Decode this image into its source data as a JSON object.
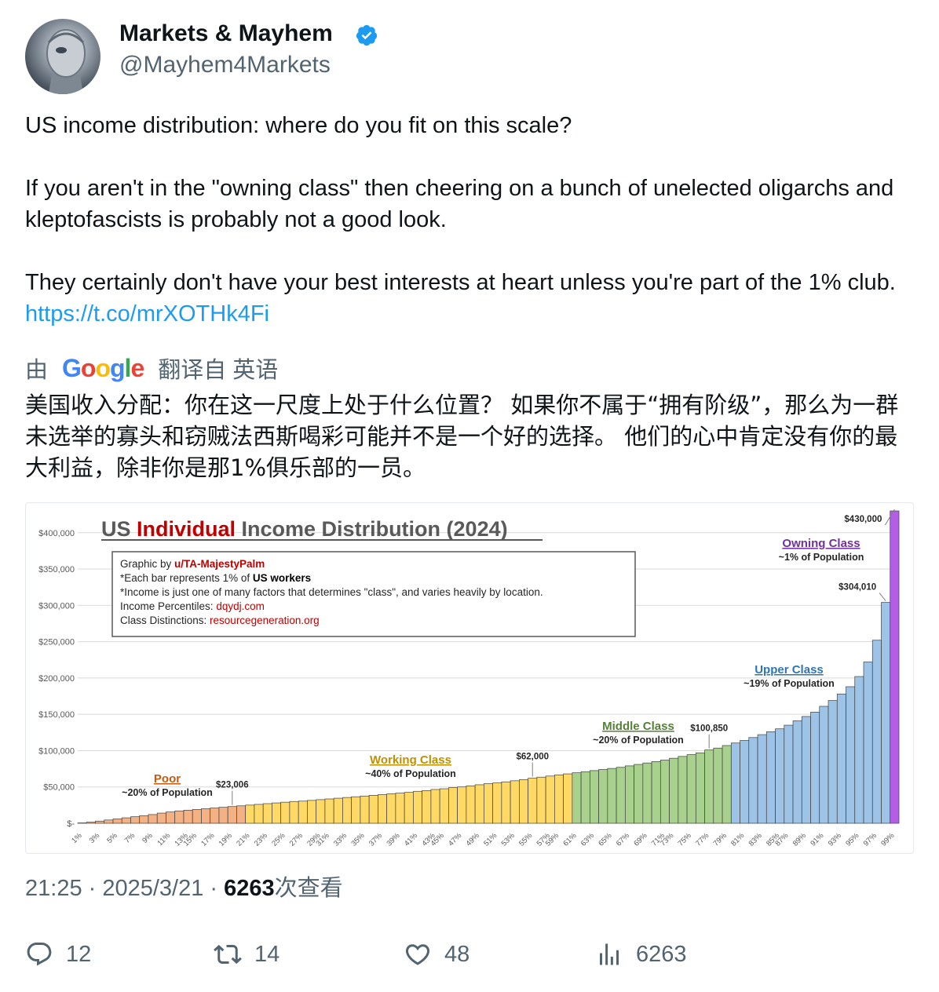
{
  "author": {
    "display_name": "Markets & Mayhem",
    "handle": "@Mayhem4Markets",
    "verified": true,
    "avatar_icon": "robot-avatar-icon"
  },
  "tweet": {
    "line1": "US income distribution: where do you fit on this scale?",
    "line2": "If you aren't in the \"owning class\" then cheering on a bunch of unelected oligarchs and kleptofascists is probably not a good look.",
    "line3": "They certainly don't have your best interests at heart unless you're part of the 1% club.",
    "link": "https://t.co/mrXOTHk4Fi"
  },
  "translation": {
    "prefix": "由",
    "provider": "Google",
    "suffix": "翻译自 英语",
    "text": "美国收入分配：你在这一尺度上处于什么位置？ 如果你不属于“拥有阶级”，那么为一群未选举的寡头和窃贼法西斯喝彩可能并不是一个好的选择。 他们的心中肯定没有你的最大利益，除非你是那1%俱乐部的一员。"
  },
  "chart_data": {
    "type": "bar",
    "title_parts": [
      "US ",
      "Individual",
      " Income Distribution (2024)"
    ],
    "info_lines": [
      {
        "a": "Graphic by ",
        "b": "u/TA-MajestyPalm",
        "c": ""
      },
      {
        "a": "*Each bar represents 1% of ",
        "b": "US workers",
        "c": ""
      },
      {
        "a": "*Income is just one of many factors that determines \"class\", and varies heavily by location.",
        "b": "",
        "c": ""
      },
      {
        "a": "Income Percentiles: ",
        "b": "dqydj.com",
        "c": ""
      },
      {
        "a": "Class Distinctions: ",
        "b": "resourcegeneration.org",
        "c": ""
      }
    ],
    "y_ticks": [
      {
        "v": 0,
        "label": "$-"
      },
      {
        "v": 50000,
        "label": "$50,000"
      },
      {
        "v": 100000,
        "label": "$100,000"
      },
      {
        "v": 150000,
        "label": "$150,000"
      },
      {
        "v": 200000,
        "label": "$200,000"
      },
      {
        "v": 250000,
        "label": "$250,000"
      },
      {
        "v": 300000,
        "label": "$300,000"
      },
      {
        "v": 350000,
        "label": "$350,000"
      },
      {
        "v": 400000,
        "label": "$400,000"
      }
    ],
    "ylim": [
      0,
      430000
    ],
    "x_tick_labels": [
      "1%",
      "3%",
      "5%",
      "7%",
      "9%",
      "11%",
      "13%",
      "15%",
      "17%",
      "19%",
      "21%",
      "23%",
      "25%",
      "27%",
      "29%",
      "31%",
      "33%",
      "35%",
      "37%",
      "39%",
      "41%",
      "43%",
      "45%",
      "47%",
      "49%",
      "51%",
      "53%",
      "55%",
      "57%",
      "59%",
      "61%",
      "63%",
      "65%",
      "67%",
      "69%",
      "71%",
      "73%",
      "75%",
      "77%",
      "79%",
      "81%",
      "83%",
      "85%",
      "87%",
      "89%",
      "91%",
      "93%",
      "95%",
      "97%",
      "99%"
    ],
    "values": [
      500,
      1500,
      3000,
      4500,
      6000,
      7500,
      9000,
      10500,
      12000,
      14000,
      15500,
      17000,
      18000,
      19000,
      20000,
      21000,
      22000,
      23006,
      24000,
      25000,
      26000,
      27000,
      28000,
      29000,
      30000,
      30500,
      31500,
      32500,
      33500,
      34500,
      35500,
      36500,
      37500,
      38500,
      39500,
      40500,
      41500,
      42500,
      44000,
      45000,
      46500,
      47500,
      49000,
      50000,
      51500,
      53000,
      54500,
      55500,
      57000,
      58500,
      60000,
      62000,
      63500,
      65000,
      66500,
      68000,
      69500,
      71000,
      72500,
      74000,
      75500,
      77000,
      79000,
      81000,
      83000,
      85000,
      87000,
      89500,
      92000,
      94500,
      97000,
      100850,
      103500,
      107000,
      110500,
      114000,
      118000,
      122000,
      126000,
      130000,
      135000,
      141000,
      147000,
      153000,
      161000,
      169000,
      178000,
      188000,
      202000,
      222000,
      252000,
      304010,
      430000
    ],
    "class_ranges": [
      {
        "name": "Poor",
        "sub": "~20% of Population",
        "start": 0,
        "end": 20,
        "color": "#f4b183",
        "label_color": "#c55a11"
      },
      {
        "name": "Working Class",
        "sub": "~40% of Population",
        "start": 20,
        "end": 60,
        "color": "#ffd966",
        "label_color": "#bf9000"
      },
      {
        "name": "Middle Class",
        "sub": "~20% of Population",
        "start": 60,
        "end": 80,
        "color": "#a9d18e",
        "label_color": "#548235"
      },
      {
        "name": "Upper Class",
        "sub": "~19% of Population",
        "start": 80,
        "end": 99,
        "color": "#9dc3e6",
        "label_color": "#2e75b6"
      },
      {
        "name": "Owning Class",
        "sub": "~1% of Population",
        "start": 99,
        "end": 100,
        "color": "#b45ee6",
        "label_color": "#7030a0"
      }
    ],
    "annotations": [
      {
        "label": "$23,006",
        "value": 23006
      },
      {
        "label": "$62,000",
        "value": 62000
      },
      {
        "label": "$100,850",
        "value": 100850
      },
      {
        "label": "$304,010",
        "value": 304010
      },
      {
        "label": "$430,000",
        "value": 430000
      }
    ],
    "colors": {
      "title_accent": "#c00000",
      "text": "#404040",
      "link_red": "#c00000",
      "grid": "#d9d9d9"
    }
  },
  "meta": {
    "time": "21:25",
    "sep1": " · ",
    "date": "2025/3/21",
    "sep2": " · ",
    "views": "6263",
    "views_suffix": "次查看"
  },
  "actions": {
    "replies": "12",
    "retweets": "14",
    "likes": "48",
    "views": "6263"
  }
}
